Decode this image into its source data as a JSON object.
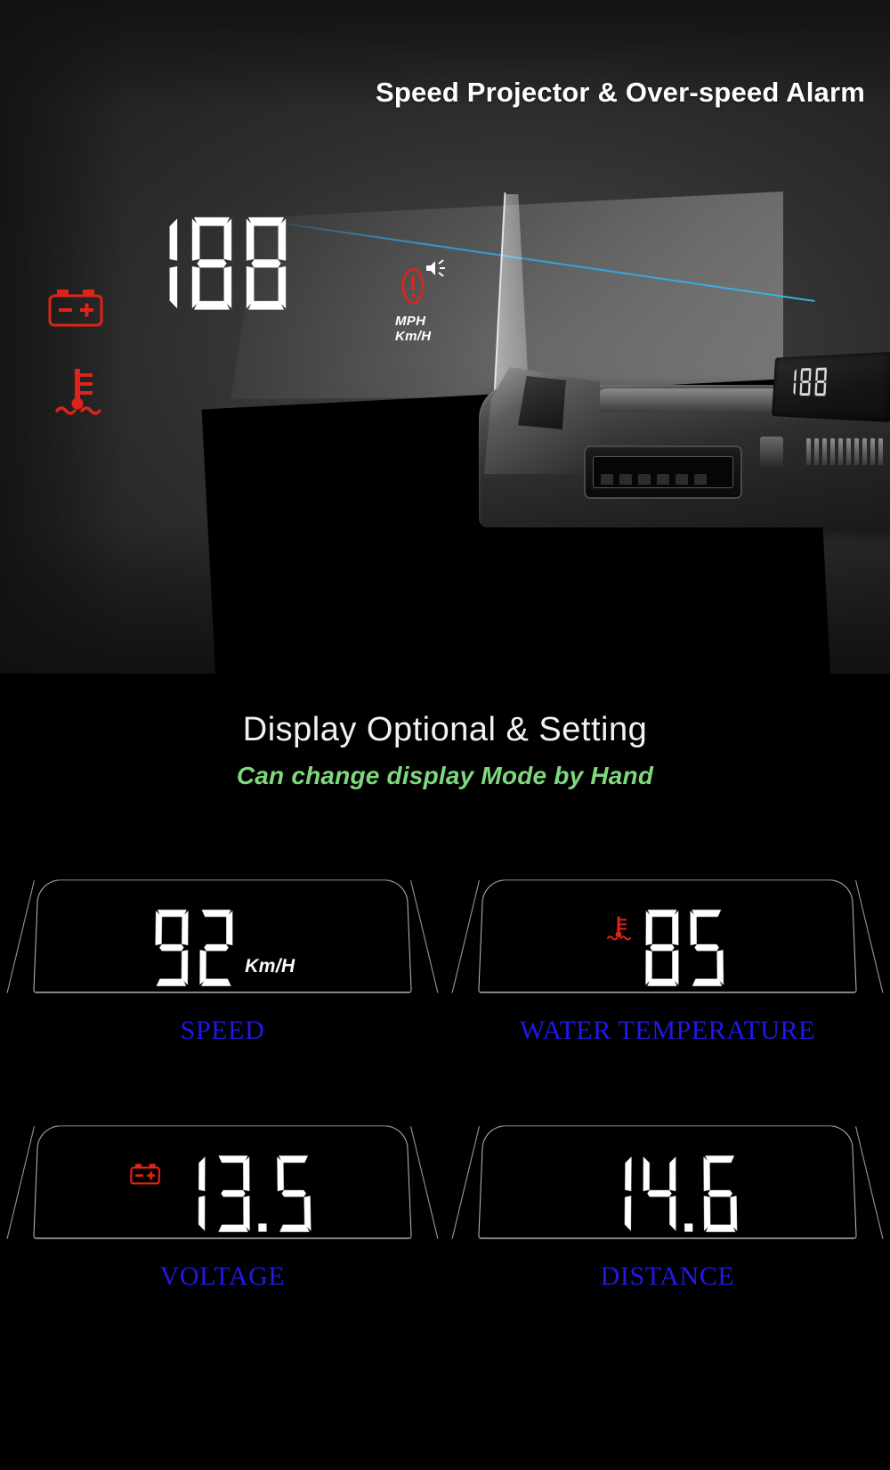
{
  "hero": {
    "title": "Speed Projector & Over-speed Alarm",
    "projected_value": "188",
    "unit_primary": "MPH",
    "unit_secondary": "Km/H",
    "alarm_icon": "over-speed-alarm-icon",
    "sound_icon": "sound-wave-icon",
    "warning_icons": [
      {
        "name": "battery-warning-icon",
        "color": "#e02318"
      },
      {
        "name": "coolant-temperature-warning-icon",
        "color": "#e02318"
      }
    ],
    "device_screen_value": "188",
    "beam_color": "#2f9ad6"
  },
  "lower": {
    "heading": "Display Optional & Setting",
    "subheading": "Can change display Mode by Hand",
    "subheading_color": "#7ed97e",
    "label_color": "#2119e8",
    "panels": [
      {
        "value": "92",
        "unit": "Km/H",
        "icon": "",
        "label": "SPEED"
      },
      {
        "value": "85",
        "unit": "",
        "icon": "coolant-temperature-warning-icon",
        "label": "WATER TEMPERATURE"
      },
      {
        "value": "13.5",
        "unit": "",
        "icon": "battery-warning-icon",
        "label": "VOLTAGE"
      },
      {
        "value": "14.6",
        "unit": "",
        "icon": "",
        "label": "DISTANCE"
      }
    ]
  }
}
